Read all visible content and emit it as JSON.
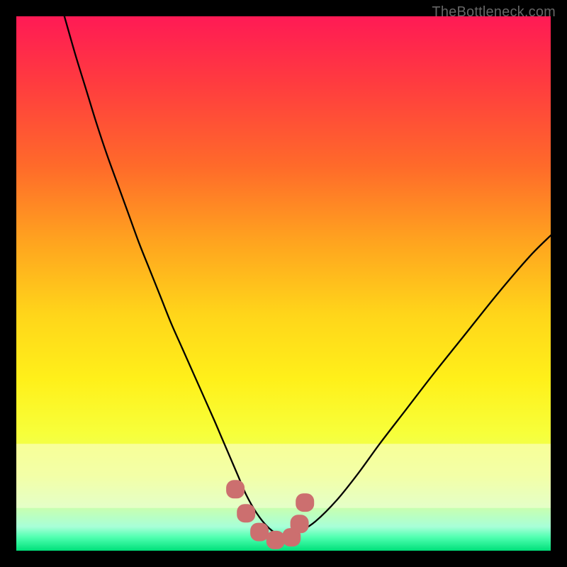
{
  "watermark": "TheBottleneck.com",
  "chart_data": {
    "type": "line",
    "title": "",
    "xlabel": "",
    "ylabel": "",
    "xlim": [
      0,
      100
    ],
    "ylim": [
      0,
      100
    ],
    "gradient": {
      "stops": [
        {
          "offset": 0.0,
          "color": "#ff1a55"
        },
        {
          "offset": 0.12,
          "color": "#ff3a40"
        },
        {
          "offset": 0.28,
          "color": "#ff6a2a"
        },
        {
          "offset": 0.42,
          "color": "#ffa31f"
        },
        {
          "offset": 0.56,
          "color": "#ffd61a"
        },
        {
          "offset": 0.68,
          "color": "#fff01a"
        },
        {
          "offset": 0.78,
          "color": "#f7ff3a"
        },
        {
          "offset": 0.86,
          "color": "#e8ff66"
        },
        {
          "offset": 0.92,
          "color": "#c8ffb0"
        },
        {
          "offset": 0.955,
          "color": "#a8ffd8"
        },
        {
          "offset": 0.975,
          "color": "#4fffb0"
        },
        {
          "offset": 1.0,
          "color": "#00e07a"
        }
      ],
      "pale_band": {
        "y_from": 0.8,
        "y_to": 0.92
      }
    },
    "series": [
      {
        "name": "bottleneck-curve",
        "color": "#000000",
        "stroke_width": 2.3,
        "x": [
          9.0,
          11,
          13,
          15,
          17,
          19,
          21,
          23,
          25,
          27,
          29,
          31,
          33,
          35,
          37,
          38.5,
          40,
          41.5,
          43,
          45,
          47,
          49,
          51,
          53,
          56,
          60,
          64,
          68,
          73,
          78,
          84,
          90,
          96,
          100
        ],
        "values": [
          100,
          93,
          86.5,
          80,
          74,
          68.5,
          63,
          57.5,
          52.5,
          47.5,
          42.5,
          38,
          33.5,
          29,
          24.5,
          21,
          17.5,
          14,
          10.5,
          7.0,
          4.5,
          3.0,
          2.5,
          3.5,
          5.5,
          9.5,
          14.5,
          20,
          26.5,
          33,
          40.5,
          48,
          55,
          59
        ]
      },
      {
        "name": "optimal-zone-marker",
        "marker_color": "#cc6f6f",
        "marker_type": "rounded-square",
        "marker_size": 26,
        "x": [
          41.0,
          43.0,
          45.5,
          48.5,
          51.5,
          53.0,
          54.0
        ],
        "values": [
          11.5,
          7.0,
          3.5,
          2.0,
          2.5,
          5.0,
          9.0
        ]
      }
    ],
    "annotations": []
  }
}
